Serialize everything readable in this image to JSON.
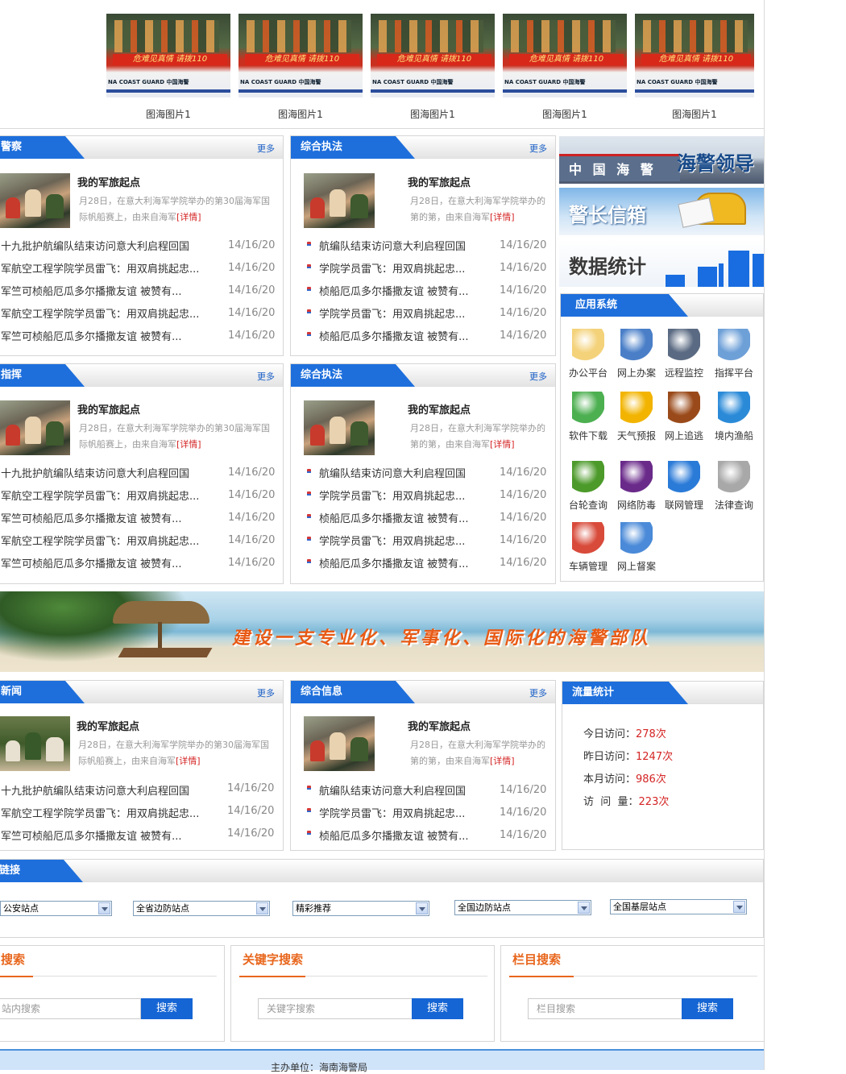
{
  "gallery": {
    "items": [
      {
        "caption": "图海图片1",
        "banner": "危难见真情 请拨110",
        "hull": "NA COAST GUARD  中国海警"
      },
      {
        "caption": "图海图片1",
        "banner": "危难见真情 请拨110",
        "hull": "NA COAST GUARD  中国海警"
      },
      {
        "caption": "图海图片1",
        "banner": "危难见真情 请拨110",
        "hull": "NA COAST GUARD  中国海警"
      },
      {
        "caption": "图海图片1",
        "banner": "危难见真情 请拨110",
        "hull": "NA COAST GUARD  中国海警"
      },
      {
        "caption": "图海图片1",
        "banner": "危难见真情 请拨110",
        "hull": "NA COAST GUARD  中国海警"
      }
    ]
  },
  "more_label": "更多",
  "panels": {
    "p1": {
      "title": "警察",
      "feat_title": "我的军旅起点",
      "feat_desc": "月28日，在意大利海军学院举办的第30届海军国际帆船赛上，由来自海军",
      "detail": "[详情]",
      "items": [
        {
          "t": "十九批护航编队结束访问意大利启程回国",
          "d": "14/16/20"
        },
        {
          "t": "军航空工程学院学员雷飞：用双肩挑起忠...",
          "d": "14/16/20"
        },
        {
          "t": "军竺可桢船厄瓜多尔播撒友谊 被赞有...",
          "d": "14/16/20"
        },
        {
          "t": "军航空工程学院学员雷飞：用双肩挑起忠...",
          "d": "14/16/20"
        },
        {
          "t": "军竺可桢船厄瓜多尔播撒友谊 被赞有...",
          "d": "14/16/20"
        }
      ]
    },
    "p2": {
      "title": "综合执法",
      "feat_title": "我的军旅起点",
      "feat_desc": "月28日，在意大利海军学院举办的第",
      "detail": "[详情]",
      "items": [
        {
          "t": "航编队结束访问意大利启程回国",
          "d": "14/16/20"
        },
        {
          "t": "学院学员雷飞：用双肩挑起忠...",
          "d": "14/16/20"
        },
        {
          "t": "桢船厄瓜多尔播撒友谊 被赞有...",
          "d": "14/16/20"
        },
        {
          "t": "学院学员雷飞：用双肩挑起忠...",
          "d": "14/16/20"
        },
        {
          "t": "桢船厄瓜多尔播撒友谊 被赞有...",
          "d": "14/16/20"
        }
      ]
    },
    "p3": {
      "title": "指挥",
      "feat_title": "我的军旅起点",
      "feat_desc": "月28日，在意大利海军学院举办的第30届海军国际帆船赛上，由来自海军",
      "detail": "[详情]",
      "items": [
        {
          "t": "十九批护航编队结束访问意大利启程回国",
          "d": "14/16/20"
        },
        {
          "t": "军航空工程学院学员雷飞：用双肩挑起忠...",
          "d": "14/16/20"
        },
        {
          "t": "军竺可桢船厄瓜多尔播撒友谊 被赞有...",
          "d": "14/16/20"
        },
        {
          "t": "军航空工程学院学员雷飞：用双肩挑起忠...",
          "d": "14/16/20"
        },
        {
          "t": "军竺可桢船厄瓜多尔播撒友谊 被赞有...",
          "d": "14/16/20"
        }
      ]
    },
    "p4": {
      "title": "综合执法",
      "feat_title": "我的军旅起点",
      "feat_desc": "月28日，在意大利海军学院举办的第",
      "detail": "[详情]",
      "items": [
        {
          "t": "航编队结束访问意大利启程回国",
          "d": "14/16/20"
        },
        {
          "t": "学院学员雷飞：用双肩挑起忠...",
          "d": "14/16/20"
        },
        {
          "t": "桢船厄瓜多尔播撒友谊 被赞有...",
          "d": "14/16/20"
        },
        {
          "t": "学院学员雷飞：用双肩挑起忠...",
          "d": "14/16/20"
        },
        {
          "t": "桢船厄瓜多尔播撒友谊 被赞有...",
          "d": "14/16/20"
        }
      ]
    },
    "p5": {
      "title": "新闻",
      "feat_title": "我的军旅起点",
      "feat_desc": "月28日，在意大利海军学院举办的第30届海军国际帆船赛上，由来自海军",
      "detail": "[详情]",
      "items": [
        {
          "t": "十九批护航编队结束访问意大利启程回国",
          "d": "14/16/20"
        },
        {
          "t": "军航空工程学院学员雷飞：用双肩挑起忠...",
          "d": "14/16/20"
        },
        {
          "t": "军竺可桢船厄瓜多尔播撒友谊 被赞有...",
          "d": "14/16/20"
        }
      ]
    },
    "p6": {
      "title": "综合信息",
      "feat_title": "我的军旅起点",
      "feat_desc": "月28日，在意大利海军学院举办的第",
      "detail": "[详情]",
      "items": [
        {
          "t": "航编队结束访问意大利启程回国",
          "d": "14/16/20"
        },
        {
          "t": "学院学员雷飞：用双肩挑起忠...",
          "d": "14/16/20"
        },
        {
          "t": "桢船厄瓜多尔播撒友谊 被赞有...",
          "d": "14/16/20"
        }
      ]
    }
  },
  "side_banners": {
    "leader": "海警领导",
    "mailbox": "警长信箱",
    "stats": "数据统计",
    "ship_text": "中 国 海 警"
  },
  "apps": {
    "title": "应用系统",
    "items": [
      {
        "label": "办公平台",
        "icon": "notepad-icon"
      },
      {
        "label": "网上办案",
        "icon": "laptop-icon"
      },
      {
        "label": "远程监控",
        "icon": "monitor-icon"
      },
      {
        "label": "指挥平台",
        "icon": "network-icon"
      },
      {
        "label": "软件下载",
        "icon": "download-icon"
      },
      {
        "label": "天气预报",
        "icon": "weather-icon"
      },
      {
        "label": "网上追逃",
        "icon": "crab-icon"
      },
      {
        "label": "境内渔船",
        "icon": "ship-icon"
      },
      {
        "label": "台轮查询",
        "icon": "magnifier-icon"
      },
      {
        "label": "网络防毒",
        "icon": "shield-icon"
      },
      {
        "label": "联网管理",
        "icon": "globe-icon"
      },
      {
        "label": "法律查询",
        "icon": "scales-icon"
      },
      {
        "label": "车辆管理",
        "icon": "car-icon"
      },
      {
        "label": "网上督案",
        "icon": "email-icon"
      }
    ]
  },
  "banner_slogan": "建设一支专业化、军事化、国际化的海警部队",
  "traffic": {
    "title": "流量统计",
    "rows": [
      {
        "label": "今日访问：",
        "value": "278次"
      },
      {
        "label": "昨日访问：",
        "value": "1247次"
      },
      {
        "label": "本月访问：",
        "value": "986次"
      },
      {
        "label": "访  问  量：",
        "value": "223次"
      }
    ]
  },
  "links": {
    "title": "链接",
    "selects": [
      "公安站点",
      "全省边防站点",
      "精彩推荐",
      "全国边防站点",
      "全国基层站点"
    ]
  },
  "search": [
    {
      "title": "搜索",
      "placeholder": "站内搜索",
      "button": "搜索"
    },
    {
      "title": "关键字搜索",
      "placeholder": "关键字搜索",
      "button": "搜索"
    },
    {
      "title": "栏目搜索",
      "placeholder": "栏目搜索",
      "button": "搜索"
    }
  ],
  "footer": {
    "text": "主办单位：海南海警局"
  },
  "colors": {
    "tab_blue": "#1e6fdc",
    "accent_red": "#d42424",
    "search_orange": "#e8661c",
    "button_blue": "#1565d4"
  }
}
